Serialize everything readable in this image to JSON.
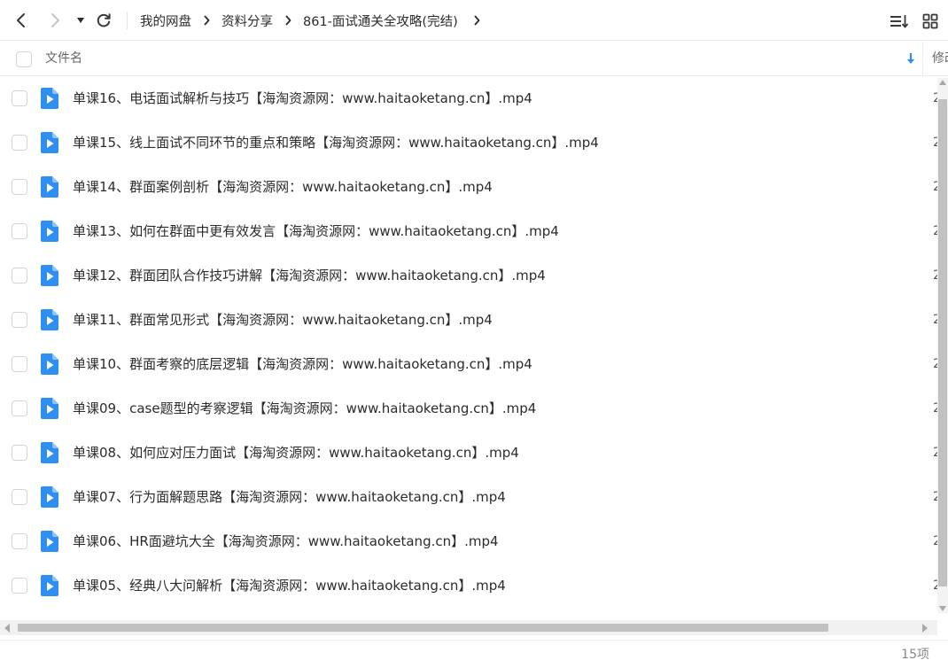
{
  "colors": {
    "accent": "#2f8ff0",
    "text": "#2b2b2b",
    "muted": "#888888"
  },
  "nav": {
    "back_icon": "chevron-left-icon",
    "forward_icon": "chevron-right-icon",
    "history_icon": "caret-down-icon",
    "refresh_icon": "refresh-icon"
  },
  "breadcrumb": {
    "items": [
      "我的网盘",
      "资料分享",
      "861-面试通关全攻略(完结)"
    ]
  },
  "toolbar": {
    "sort_icon": "sort-list-icon",
    "view_icon": "grid-view-icon"
  },
  "columns": {
    "name": "文件名",
    "modified": "修改"
  },
  "files": [
    {
      "name": "单课16、电话面试解析与技巧【海淘资源网：www.haitaoketang.cn】.mp4",
      "modified": "2"
    },
    {
      "name": "单课15、线上面试不同环节的重点和策略【海淘资源网：www.haitaoketang.cn】.mp4",
      "modified": "2"
    },
    {
      "name": "单课14、群面案例剖析【海淘资源网：www.haitaoketang.cn】.mp4",
      "modified": "2"
    },
    {
      "name": "单课13、如何在群面中更有效发言【海淘资源网：www.haitaoketang.cn】.mp4",
      "modified": "2"
    },
    {
      "name": "单课12、群面团队合作技巧讲解【海淘资源网：www.haitaoketang.cn】.mp4",
      "modified": "2"
    },
    {
      "name": "单课11、群面常见形式【海淘资源网：www.haitaoketang.cn】.mp4",
      "modified": "2"
    },
    {
      "name": "单课10、群面考察的底层逻辑【海淘资源网：www.haitaoketang.cn】.mp4",
      "modified": "2"
    },
    {
      "name": "单课09、case题型的考察逻辑【海淘资源网：www.haitaoketang.cn】.mp4",
      "modified": "2"
    },
    {
      "name": "单课08、如何应对压力面试【海淘资源网：www.haitaoketang.cn】.mp4",
      "modified": "2"
    },
    {
      "name": "单课07、行为面解题思路【海淘资源网：www.haitaoketang.cn】.mp4",
      "modified": "2"
    },
    {
      "name": "单课06、HR面避坑大全【海淘资源网：www.haitaoketang.cn】.mp4",
      "modified": "2"
    },
    {
      "name": "单课05、经典八大问解析【海淘资源网：www.haitaoketang.cn】.mp4",
      "modified": "2"
    }
  ],
  "footer": {
    "count": "15项"
  }
}
